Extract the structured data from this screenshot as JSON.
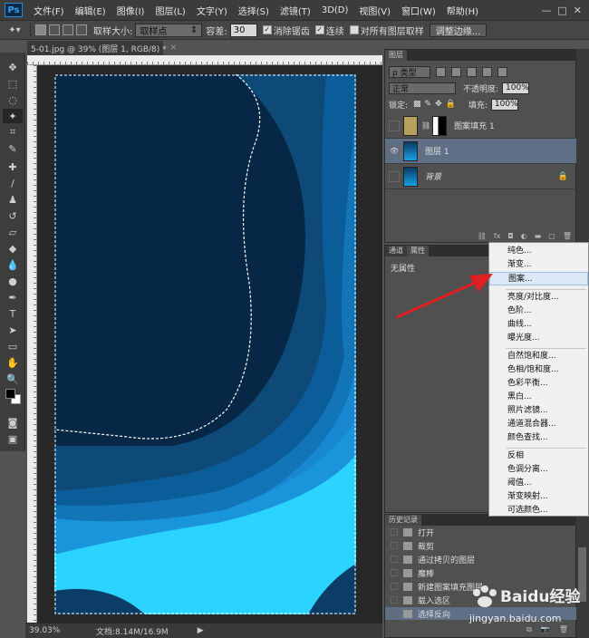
{
  "menubar": {
    "logo": "Ps",
    "items": [
      "文件(F)",
      "编辑(E)",
      "图像(I)",
      "图层(L)",
      "文字(Y)",
      "选择(S)",
      "滤镜(T)",
      "3D(D)",
      "视图(V)",
      "窗口(W)",
      "帮助(H)"
    ],
    "window_controls": [
      "—",
      "□",
      "✕"
    ]
  },
  "options": {
    "sample_size_label": "取样大小:",
    "sample_size_value": "取样点",
    "tolerance_label": "容差:",
    "tolerance_value": "30",
    "antialias_label": "消除锯齿",
    "contiguous_label": "连续",
    "all_layers_label": "对所有图层取样",
    "refine_edge_label": "调整边缘..."
  },
  "document": {
    "tab_title": "5-01.jpg @ 39% (图层 1, RGB/8) *",
    "close_glyph": "×"
  },
  "status": {
    "zoom": "39.03%",
    "doc_info": "文档:8.14M/16.9M",
    "arrow": "▶"
  },
  "layers_panel": {
    "tab_label": "图层",
    "filter_kind": "ρ 类型",
    "blend_mode": "正常",
    "opacity_label": "不透明度:",
    "opacity_value": "100%",
    "lock_label": "锁定:",
    "fill_label": "填充:",
    "fill_value": "100%",
    "layers": [
      {
        "name": "图案填充 1",
        "visible": false,
        "selected": false
      },
      {
        "name": "图层 1",
        "visible": true,
        "selected": true
      },
      {
        "name": "背景",
        "visible": false,
        "selected": false
      }
    ],
    "bottom_icons": [
      "link-icon",
      "fx-icon",
      "mask-icon",
      "adjustment-icon",
      "folder-icon",
      "new-layer-icon",
      "trash-icon"
    ]
  },
  "properties_panel": {
    "tabs": [
      "通道",
      "属性"
    ],
    "content": "无属性"
  },
  "history_panel": {
    "tab_label": "历史记录",
    "items": [
      {
        "label": "打开",
        "selected": false
      },
      {
        "label": "裁剪",
        "selected": false
      },
      {
        "label": "通过拷贝的图层",
        "selected": false
      },
      {
        "label": "魔棒",
        "selected": false
      },
      {
        "label": "新建图案填充图层",
        "selected": false
      },
      {
        "label": "载入选区",
        "selected": false
      },
      {
        "label": "选择反向",
        "selected": true
      }
    ]
  },
  "adjust_menu": {
    "groups": [
      [
        "纯色...",
        "渐变...",
        "图案..."
      ],
      [
        "亮度/对比度...",
        "色阶...",
        "曲线...",
        "曝光度..."
      ],
      [
        "自然饱和度...",
        "色相/饱和度...",
        "色彩平衡...",
        "黑白...",
        "照片滤镜...",
        "通道混合器...",
        "颜色查找..."
      ],
      [
        "反相",
        "色调分离...",
        "阈值...",
        "渐变映射...",
        "可选颜色..."
      ]
    ],
    "highlighted": "图案..."
  },
  "watermark": {
    "brand": "Baidu经验",
    "url": "jingyan.baidu.com"
  },
  "colors": {
    "accent_red": "#e02020",
    "selection_blue": "#5f6f86",
    "canvas_dark": "#0b2a45",
    "canvas_cyan": "#2ad4ff"
  }
}
